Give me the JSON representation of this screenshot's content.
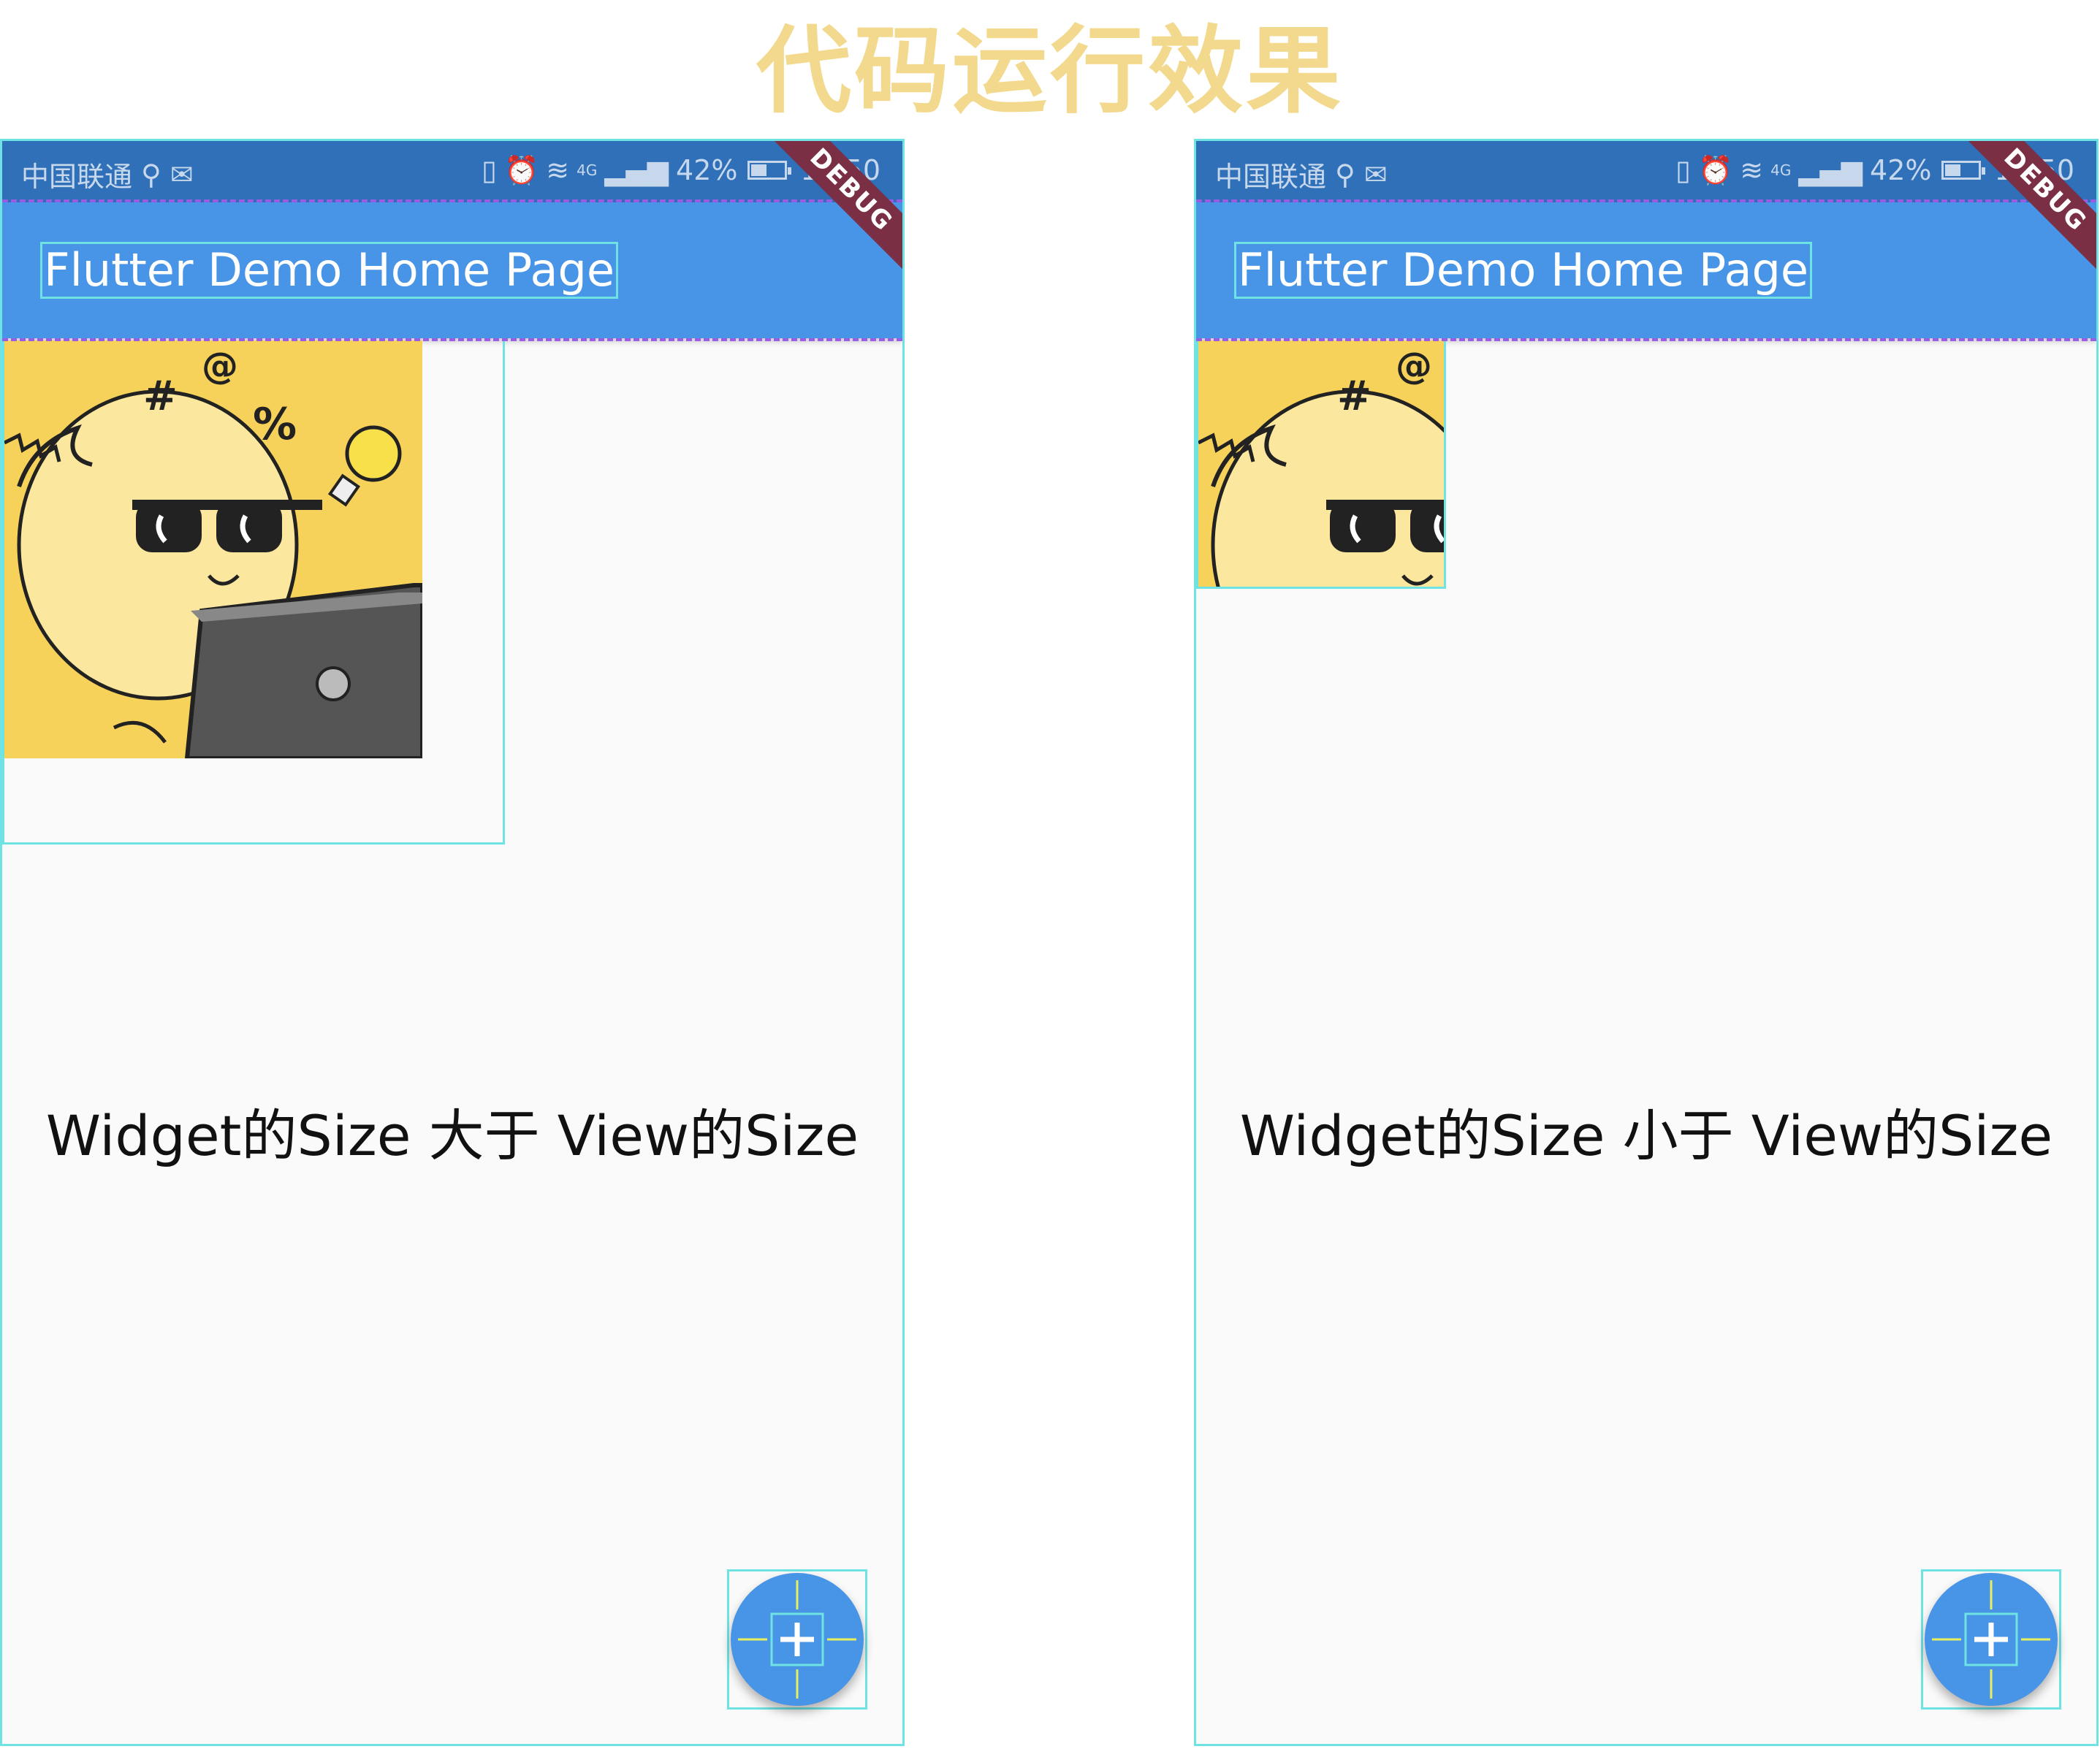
{
  "heading": "代码运行效果",
  "phones": [
    {
      "status": {
        "carrier": "中国联通",
        "battery": "42%",
        "time": "16:50",
        "network": "4G"
      },
      "appbar_title": "Flutter Demo Home Page",
      "debug_banner": "DEBUG",
      "caption": "Widget的Size 大于 View的Size",
      "fab_icon": "plus-icon"
    },
    {
      "status": {
        "carrier": "中国联通",
        "battery": "42%",
        "time": "16:50",
        "network": "4G"
      },
      "appbar_title": "Flutter Demo Home Page",
      "debug_banner": "DEBUG",
      "caption": "Widget的Size 小于 View的Size",
      "fab_icon": "plus-icon"
    }
  ],
  "colors": {
    "heading": "#f2d98e",
    "statusbar": "#2f70b9",
    "appbar": "#4894e6",
    "debug_banner": "#7a2f45",
    "debug_outline": "#6fe3e3",
    "debug_dash": "#9b5de5",
    "illustration_bg": "#f7d25a"
  }
}
